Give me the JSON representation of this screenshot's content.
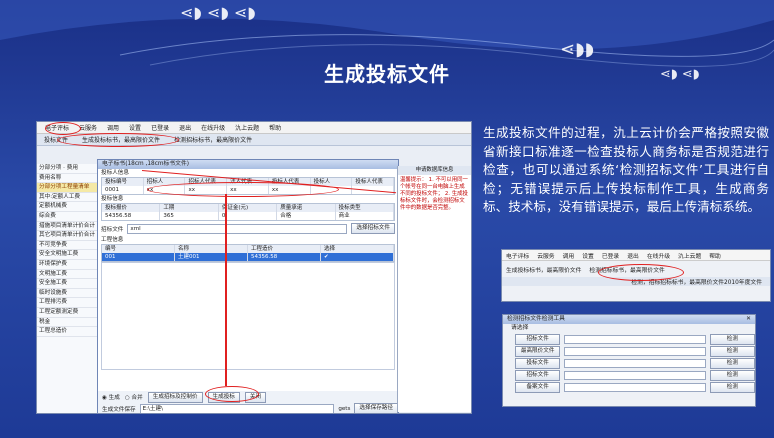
{
  "slide": {
    "title": "生成投标文件",
    "description": "生成投标文件的过程，氿上云计价会严格按照安徽省新接口标准逐一检查投标人商务标是否规范进行检查，也可以通过系统‘检测招标文件’工具进行自检；无错误提示后上传投标制作工具，生成商务标、技术标，没有错误提示，最后上传清标系统。"
  },
  "main_screenshot": {
    "menu": [
      "电子评标",
      "云服务",
      "调用",
      "设置",
      "已登录",
      "退出",
      "在线升级",
      "氿上云题",
      "帮助"
    ],
    "tabs": [
      "投标文件",
      "生成投标标书",
      "最高限价文件",
      "检测招标标书",
      "最高限价文件"
    ],
    "left_header": [
      "分部分项",
      "费用"
    ],
    "left_col": [
      "费用名称"
    ],
    "left_items": [
      "分部分项工程量清单",
      "其中:定额人工费",
      "定额机械费",
      "综合费",
      "措施项目清单计价合计",
      "其它项目清单计价合计",
      "不可竞争费",
      "安全文明施工费",
      "环境保护费",
      "文明施工费",
      "安全施工费",
      "临时设施费",
      "工程排污费",
      "工程定额测定费",
      "税金",
      "工程总造价"
    ],
    "dialog": {
      "title": "电子标书(18cm ,18cm标书文件)",
      "section1": "投标人信息",
      "grid1_head": [
        "投标编号",
        "招标人",
        "招标人代表",
        "法人代表",
        "投标人代表",
        "投标人",
        "投标人代表"
      ],
      "grid1_row": [
        "0001",
        "xx",
        "xx",
        "xx",
        "xx"
      ],
      "section2": "投标信息",
      "grid2_head": [
        "投标报价",
        "工期",
        "保证金(元)",
        "质量承诺",
        "投标类型"
      ],
      "grid2_row": [
        "54356.58",
        "365",
        "0",
        "合格",
        "商业"
      ],
      "file_label": "招标文件",
      "file_value": "xml",
      "select_btn": "选择招标文件",
      "section3": "工程信息",
      "grid3_head": [
        "编号",
        "名称",
        "工程造价",
        "选择"
      ],
      "grid3_row": [
        "001",
        "土建001",
        "54356.58",
        "✔"
      ],
      "radio1": "生成",
      "radio2": "合并",
      "btn_gen_tender": "生成招标及控制价",
      "btn_gen_bid": "生成投标",
      "btn_close": "关闭",
      "save_label": "生成文件保存",
      "save_path": "E:\\土建\\",
      "save_ext": "gets",
      "save_btn": "选择保存路径"
    },
    "check_panel": {
      "title": "申请数据库信息",
      "text": "温馨提示：\n1. 不可以用同一个帐号在同一台电脑上生成不同的投标文件；\n2. 生成投标标文件时，会检测招标文件中的数据是否完整。"
    }
  },
  "toolbar_screenshot": {
    "menu": [
      "电子评标",
      "云服务",
      "调用",
      "设置",
      "已登录",
      "退出",
      "在线升级",
      "氿上云题",
      "帮助"
    ],
    "tabs": [
      "生成投标标书",
      "最高限价文件",
      "检测招标标书",
      "最高限价文件"
    ],
    "path": "检测，招标招标标书，最高限价文件2010年度文件"
  },
  "check_dialog": {
    "title": "检测招标文件检测工具",
    "close": "✕",
    "group_label": "请选择",
    "rows": [
      {
        "label": "招标文件",
        "action": "检测"
      },
      {
        "label": "最高限价文件",
        "action": "检测"
      },
      {
        "label": "投标文件",
        "action": "检测"
      },
      {
        "label": "招标文件",
        "action": "检测"
      },
      {
        "label": "备案文件",
        "action": "检测"
      }
    ]
  },
  "colors": {
    "accent_red": "#e02020",
    "slide_bg": "#1e3a96",
    "highlight": "#2f6fd6"
  }
}
